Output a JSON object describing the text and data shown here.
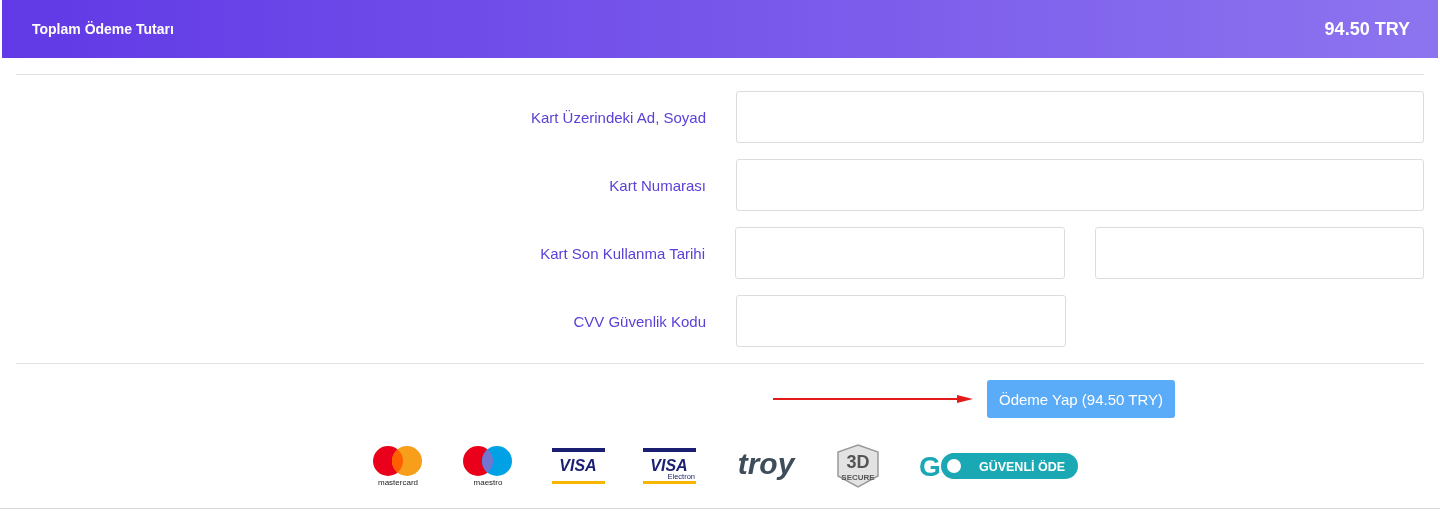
{
  "header": {
    "title": "Toplam Ödeme Tutarı",
    "amount": "94.50 TRY"
  },
  "fields": [
    {
      "label": "Kart Üzerindeki Ad, Soyad",
      "kind": "wide"
    },
    {
      "label": "Kart Numarası",
      "kind": "wide"
    },
    {
      "label": "Kart Son Kullanma Tarihi",
      "kind": "pair"
    },
    {
      "label": "CVV Güvenlik Kodu",
      "kind": "short"
    }
  ],
  "submit": {
    "label": "Ödeme Yap (94.50 TRY)"
  },
  "logos": [
    {
      "kind": "mastercard",
      "caption": "mastercard"
    },
    {
      "kind": "maestro",
      "caption": "maestro"
    },
    {
      "kind": "visa",
      "text": "VISA"
    },
    {
      "kind": "visa-electron",
      "text": "VISA",
      "caption": "Electron"
    },
    {
      "kind": "troy",
      "text": "troy"
    },
    {
      "kind": "secure3d",
      "text": "3D",
      "caption": "SECURE"
    },
    {
      "kind": "go",
      "text": "G",
      "caption": "GÜVENLİ ÖDE"
    }
  ]
}
